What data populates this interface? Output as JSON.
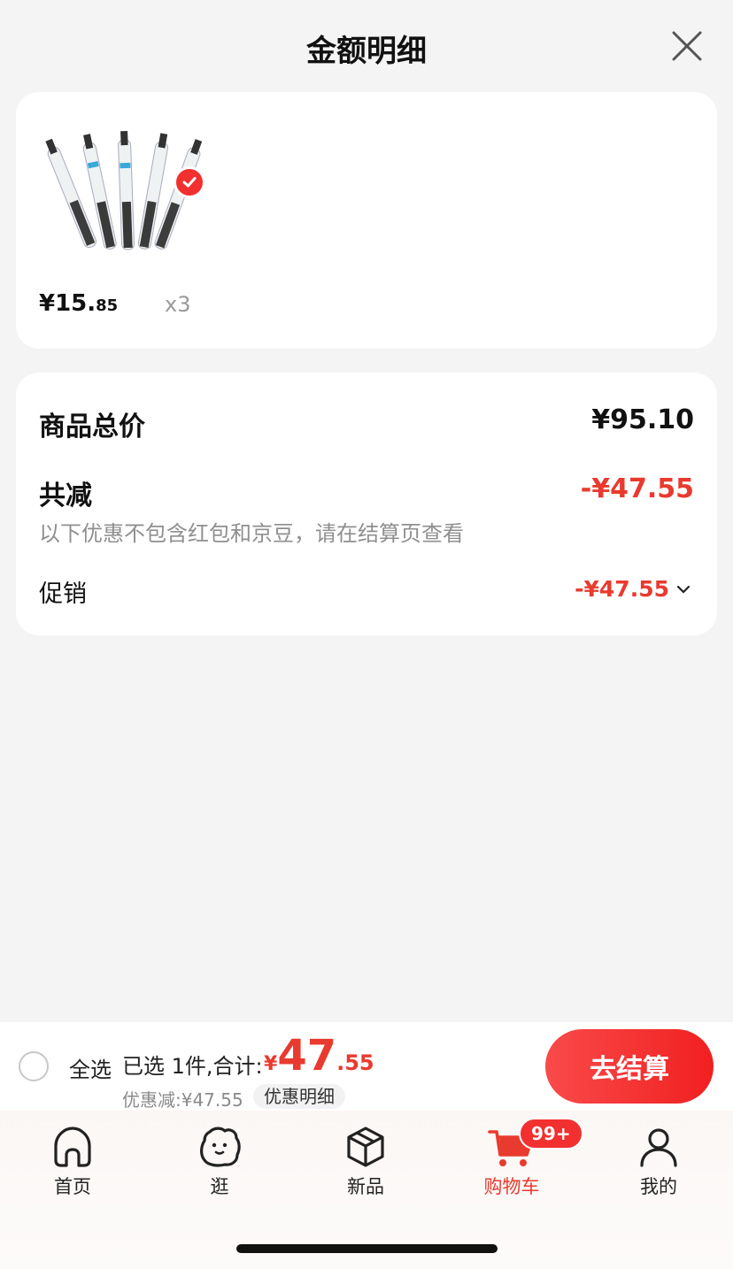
{
  "header": {
    "title": "金额明细"
  },
  "product": {
    "price_int": "¥15.",
    "price_dec": "85",
    "quantity": "x3"
  },
  "summary": {
    "total_label": "商品总价",
    "total_value": "¥95.10",
    "reduce_label": "共减",
    "reduce_value": "-¥47.55",
    "note": "以下优惠不包含红包和京豆，请在结算页查看",
    "promo_label": "促销",
    "promo_value": "-¥47.55"
  },
  "checkout": {
    "select_all": "全选",
    "selected_text": "已选 1件,合计:",
    "total_yen": "¥",
    "total_int": "47",
    "total_dec": ".55",
    "discount_text": "优惠减:¥47.55",
    "detail_chip": "优惠明细",
    "button_label": "去结算"
  },
  "tabs": [
    {
      "label": "首页",
      "icon": "home-icon"
    },
    {
      "label": "逛",
      "icon": "browse-icon"
    },
    {
      "label": "新品",
      "icon": "box-icon"
    },
    {
      "label": "购物车",
      "icon": "cart-icon",
      "badge": "99+"
    },
    {
      "label": "我的",
      "icon": "user-icon"
    }
  ],
  "colors": {
    "accent": "#e93a2f",
    "background": "#f4f4f4"
  }
}
